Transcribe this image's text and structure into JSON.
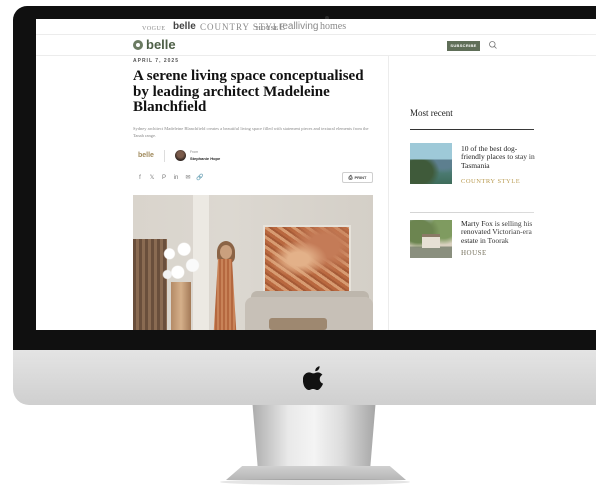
{
  "brand_bar": {
    "brands": [
      "VOGUE",
      "belle",
      "COUNTRY STYLE",
      "HOUSE",
      "realliving",
      "homes"
    ]
  },
  "header": {
    "logo": "belle",
    "subscribe_label": "SUBSCRIBE",
    "accent_color": "#5f6e58"
  },
  "article": {
    "date": "APRIL 7, 2025",
    "title": "A serene living space conceptualised by leading architect Madeleine Blanchfield",
    "standfirst": "Sydney architect Madeleine Blanchfield creates a beautiful living space filled with statement pieces and textural elements from the Tanah range.",
    "byline_brand": "belle",
    "byline_label": "From",
    "author": "Stephanie Hope",
    "share_icons": [
      "facebook-icon",
      "x-icon",
      "pinterest-icon",
      "linkedin-icon",
      "email-icon",
      "link-icon"
    ],
    "share_glyphs": [
      "f",
      "𝕏",
      "P",
      "in",
      "✉",
      "🔗"
    ],
    "print_label": "PRINT"
  },
  "sidebar": {
    "heading": "Most recent",
    "items": [
      {
        "title": "10 of the best dog-friendly places to stay in Tasmania",
        "source": "COUNTRY STYLE"
      },
      {
        "title": "Marty Fox is selling his renovated Victorian-era estate in Toorak",
        "source": "HOUSE"
      }
    ]
  }
}
